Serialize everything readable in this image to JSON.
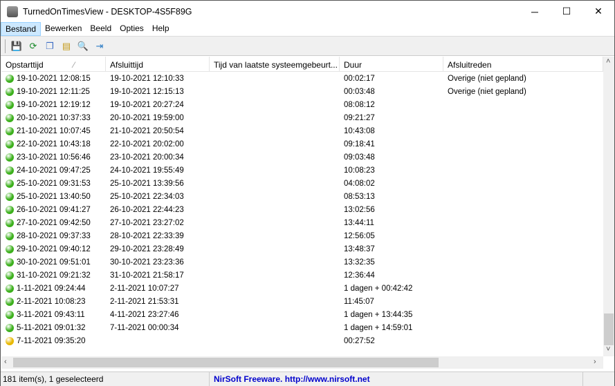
{
  "window": {
    "title": "TurnedOnTimesView  -  DESKTOP-4S5F89G",
    "minimize": "─",
    "maximize": "☐",
    "close": "✕"
  },
  "menu": [
    "Bestand",
    "Bewerken",
    "Beeld",
    "Opties",
    "Help"
  ],
  "toolbar": [
    {
      "icon": "save-icon",
      "glyph": "💾",
      "color": "#1a3e9c"
    },
    {
      "icon": "refresh-icon",
      "glyph": "⟳",
      "color": "#1a8a2a"
    },
    {
      "icon": "copy-icon",
      "glyph": "❐",
      "color": "#3b6bc4"
    },
    {
      "icon": "properties-icon",
      "glyph": "▤",
      "color": "#c49a1a"
    },
    {
      "icon": "find-icon",
      "glyph": "🔍",
      "color": "#3b6bc4"
    },
    {
      "icon": "exit-icon",
      "glyph": "⇥",
      "color": "#2a7ac4"
    }
  ],
  "columns": [
    "Opstarttijd",
    "Afsluittijd",
    "Tijd van laatste systeemgebeurt...",
    "Duur",
    "Afsluitreden"
  ],
  "sort_indicator": "⁄",
  "colors": {
    "green": "#3cb01c",
    "yellow": "#e8b800"
  },
  "rows": [
    {
      "status": "green",
      "start": "19-10-2021 12:08:15",
      "end": "19-10-2021 12:10:33",
      "last": "",
      "dur": "00:02:17",
      "reason": "Overige (niet gepland)"
    },
    {
      "status": "green",
      "start": "19-10-2021 12:11:25",
      "end": "19-10-2021 12:15:13",
      "last": "",
      "dur": "00:03:48",
      "reason": "Overige (niet gepland)"
    },
    {
      "status": "green",
      "start": "19-10-2021 12:19:12",
      "end": "19-10-2021 20:27:24",
      "last": "",
      "dur": "08:08:12",
      "reason": ""
    },
    {
      "status": "green",
      "start": "20-10-2021 10:37:33",
      "end": "20-10-2021 19:59:00",
      "last": "",
      "dur": "09:21:27",
      "reason": ""
    },
    {
      "status": "green",
      "start": "21-10-2021 10:07:45",
      "end": "21-10-2021 20:50:54",
      "last": "",
      "dur": "10:43:08",
      "reason": ""
    },
    {
      "status": "green",
      "start": "22-10-2021 10:43:18",
      "end": "22-10-2021 20:02:00",
      "last": "",
      "dur": "09:18:41",
      "reason": ""
    },
    {
      "status": "green",
      "start": "23-10-2021 10:56:46",
      "end": "23-10-2021 20:00:34",
      "last": "",
      "dur": "09:03:48",
      "reason": ""
    },
    {
      "status": "green",
      "start": "24-10-2021 09:47:25",
      "end": "24-10-2021 19:55:49",
      "last": "",
      "dur": "10:08:23",
      "reason": ""
    },
    {
      "status": "green",
      "start": "25-10-2021 09:31:53",
      "end": "25-10-2021 13:39:56",
      "last": "",
      "dur": "04:08:02",
      "reason": ""
    },
    {
      "status": "green",
      "start": "25-10-2021 13:40:50",
      "end": "25-10-2021 22:34:03",
      "last": "",
      "dur": "08:53:13",
      "reason": ""
    },
    {
      "status": "green",
      "start": "26-10-2021 09:41:27",
      "end": "26-10-2021 22:44:23",
      "last": "",
      "dur": "13:02:56",
      "reason": ""
    },
    {
      "status": "green",
      "start": "27-10-2021 09:42:50",
      "end": "27-10-2021 23:27:02",
      "last": "",
      "dur": "13:44:11",
      "reason": ""
    },
    {
      "status": "green",
      "start": "28-10-2021 09:37:33",
      "end": "28-10-2021 22:33:39",
      "last": "",
      "dur": "12:56:05",
      "reason": ""
    },
    {
      "status": "green",
      "start": "29-10-2021 09:40:12",
      "end": "29-10-2021 23:28:49",
      "last": "",
      "dur": "13:48:37",
      "reason": ""
    },
    {
      "status": "green",
      "start": "30-10-2021 09:51:01",
      "end": "30-10-2021 23:23:36",
      "last": "",
      "dur": "13:32:35",
      "reason": ""
    },
    {
      "status": "green",
      "start": "31-10-2021 09:21:32",
      "end": "31-10-2021 21:58:17",
      "last": "",
      "dur": "12:36:44",
      "reason": ""
    },
    {
      "status": "green",
      "start": "1-11-2021 09:24:44",
      "end": "2-11-2021 10:07:27",
      "last": "",
      "dur": "1 dagen + 00:42:42",
      "reason": ""
    },
    {
      "status": "green",
      "start": "2-11-2021 10:08:23",
      "end": "2-11-2021 21:53:31",
      "last": "",
      "dur": "11:45:07",
      "reason": ""
    },
    {
      "status": "green",
      "start": "3-11-2021 09:43:11",
      "end": "4-11-2021 23:27:46",
      "last": "",
      "dur": "1 dagen + 13:44:35",
      "reason": ""
    },
    {
      "status": "green",
      "start": "5-11-2021 09:01:32",
      "end": "7-11-2021 00:00:34",
      "last": "",
      "dur": "1 dagen + 14:59:01",
      "reason": ""
    },
    {
      "status": "yellow",
      "start": "7-11-2021 09:35:20",
      "end": "",
      "last": "",
      "dur": "00:27:52",
      "reason": ""
    }
  ],
  "status": {
    "count": "181 item(s), 1 geselecteerd",
    "credit": "NirSoft Freeware.  http://www.nirsoft.net"
  }
}
